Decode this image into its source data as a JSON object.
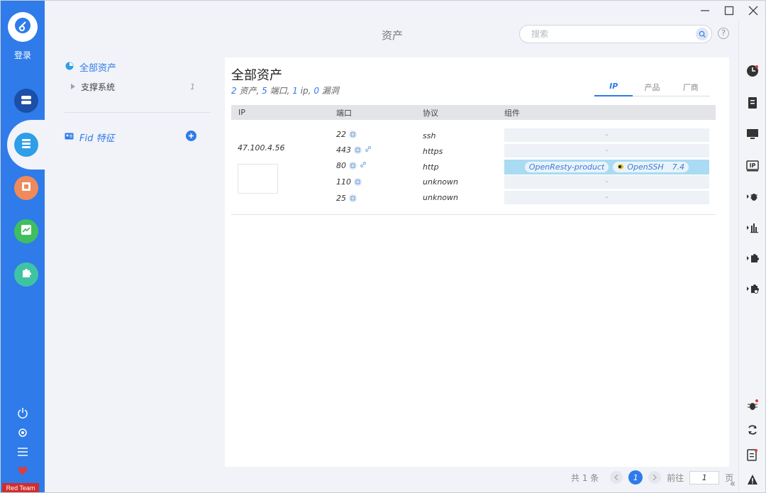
{
  "sidebar": {
    "login_label": "登录",
    "badge_label": "Red Team"
  },
  "header": {
    "title": "资产",
    "search_placeholder": "搜索",
    "help_label": "?"
  },
  "side_panel": {
    "all_assets_label": "全部资产",
    "support_system_label": "支撑系统",
    "support_system_count": "1",
    "fid_label": "Fid 特征"
  },
  "main": {
    "title": "全部资产",
    "summary": {
      "assets_count": "2",
      "assets_label": "资产,",
      "ports_count": "5",
      "ports_label": "端口,",
      "ip_count": "1",
      "ip_label": "ip,",
      "vuln_count": "0",
      "vuln_label": "漏洞"
    },
    "tabs": [
      {
        "label": "IP"
      },
      {
        "label": "产品"
      },
      {
        "label": "厂商"
      }
    ],
    "columns": {
      "ip": "IP",
      "port": "端口",
      "protocol": "协议",
      "component": "组件"
    },
    "row": {
      "ip": "47.100.4.56",
      "ports": [
        {
          "port": "22",
          "protocol": "ssh",
          "component": "-"
        },
        {
          "port": "443",
          "protocol": "https",
          "component": "-"
        },
        {
          "port": "80",
          "protocol": "http",
          "component": ""
        },
        {
          "port": "110",
          "protocol": "unknown",
          "component": "-"
        },
        {
          "port": "25",
          "protocol": "unknown",
          "component": "-"
        }
      ],
      "highlight_components": {
        "chip1": "OpenResty-product",
        "chip2_name": "OpenSSH",
        "chip2_version": "7.4"
      }
    }
  },
  "pagination": {
    "total_label": "共 1 条",
    "current_page": "1",
    "goto_label": "前往",
    "goto_value": "1",
    "page_unit": "页",
    "collapse_label": "«"
  },
  "colors": {
    "accent": "#2f7bea",
    "badge_red": "#cf2e2e",
    "highlight_row": "#a9dbf2"
  }
}
